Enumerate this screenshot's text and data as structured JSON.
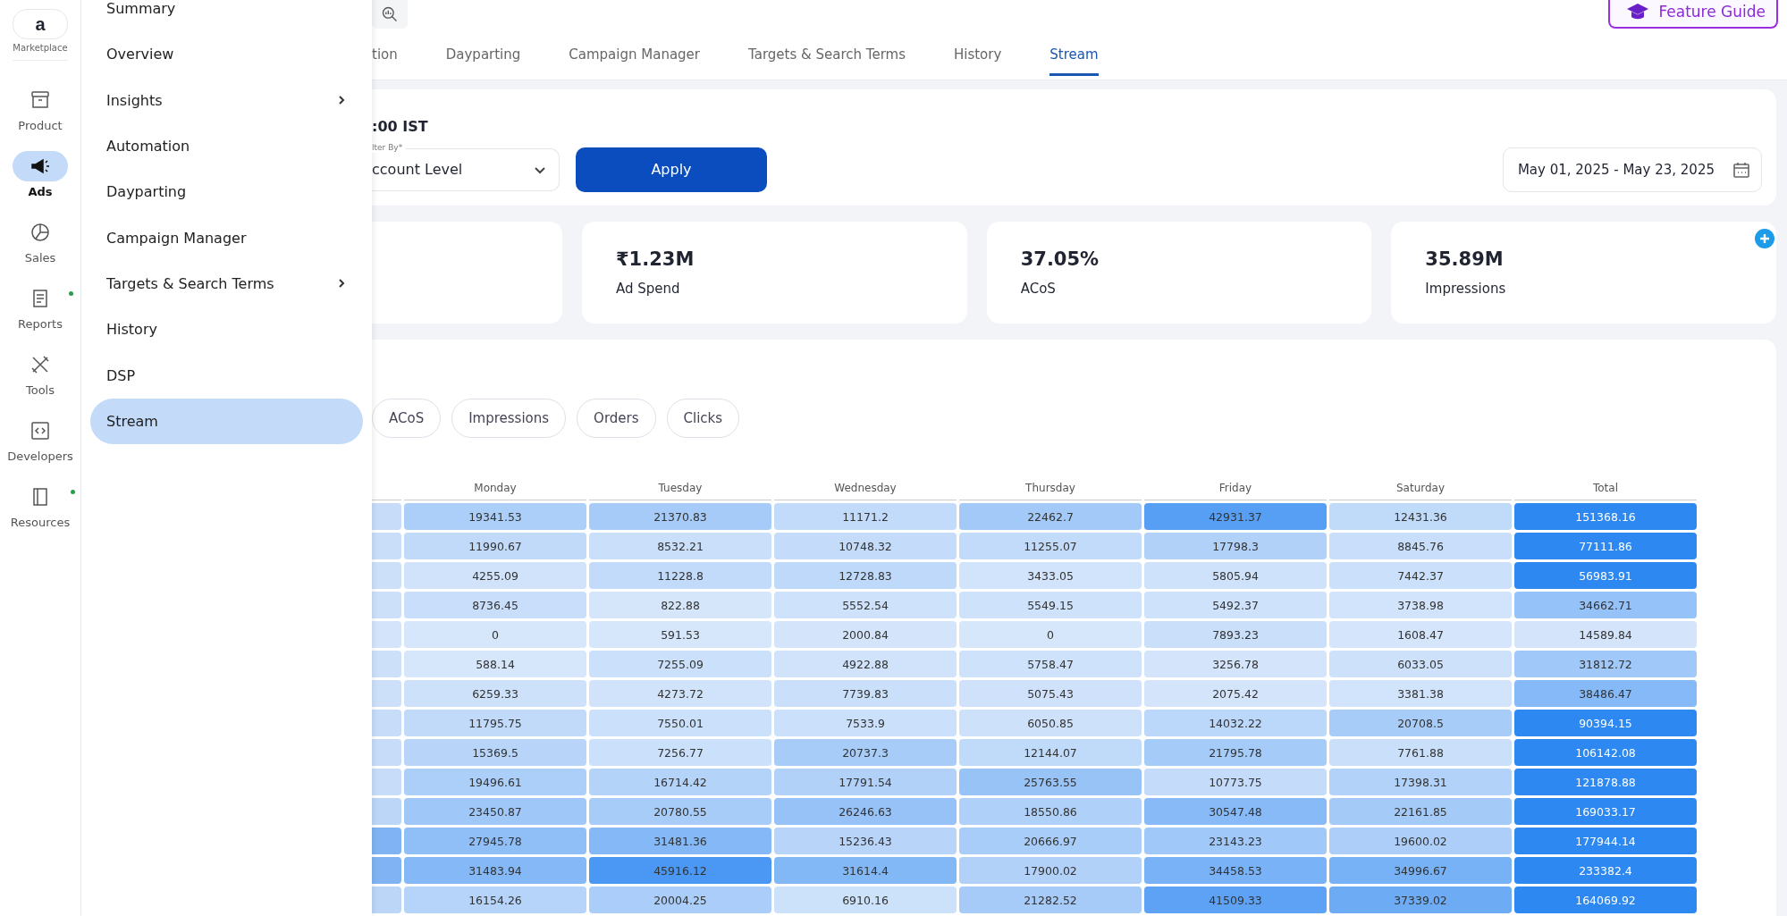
{
  "rail": {
    "logo_letter": "a",
    "logo_label": "Marketplace",
    "items": [
      {
        "label": "Product",
        "selected": false,
        "dot": false
      },
      {
        "label": "Ads",
        "selected": true,
        "dot": false
      },
      {
        "label": "Sales",
        "selected": false,
        "dot": false
      },
      {
        "label": "Reports",
        "selected": false,
        "dot": true
      },
      {
        "label": "Tools",
        "selected": false,
        "dot": false
      },
      {
        "label": "Developers",
        "selected": false,
        "dot": false
      },
      {
        "label": "Resources",
        "selected": false,
        "dot": true
      }
    ]
  },
  "menu": {
    "items": [
      {
        "label": "Summary",
        "has_submenu": false,
        "selected": false
      },
      {
        "label": "Overview",
        "has_submenu": false,
        "selected": false
      },
      {
        "label": "Insights",
        "has_submenu": true,
        "selected": false
      },
      {
        "label": "Automation",
        "has_submenu": false,
        "selected": false
      },
      {
        "label": "Dayparting",
        "has_submenu": false,
        "selected": false
      },
      {
        "label": "Campaign Manager",
        "has_submenu": false,
        "selected": false
      },
      {
        "label": "Targets & Search Terms",
        "has_submenu": true,
        "selected": false
      },
      {
        "label": "History",
        "has_submenu": false,
        "selected": false
      },
      {
        "label": "DSP",
        "has_submenu": false,
        "selected": false
      },
      {
        "label": "Stream",
        "has_submenu": false,
        "selected": true
      }
    ]
  },
  "feature_guide": {
    "label": "Feature Guide"
  },
  "tabs": [
    {
      "label": "tion",
      "selected": false
    },
    {
      "label": "Dayparting",
      "selected": false
    },
    {
      "label": "Campaign Manager",
      "selected": false
    },
    {
      "label": "Targets & Search Terms",
      "selected": false
    },
    {
      "label": "History",
      "selected": false
    },
    {
      "label": "Stream",
      "selected": true
    }
  ],
  "filter": {
    "time_text": ":00 IST",
    "filter_label": "lter By*",
    "filter_value": "ccount Level",
    "apply": "Apply",
    "date_range": "May 01, 2025 - May 23, 2025"
  },
  "metrics": [
    {
      "value": "₹1.23M",
      "label": "Ad Spend"
    },
    {
      "value": "37.05%",
      "label": "ACoS"
    },
    {
      "value": "35.89M",
      "label": "Impressions"
    }
  ],
  "chips": [
    {
      "label": "ACoS",
      "selected": false
    },
    {
      "label": "Impressions",
      "selected": false
    },
    {
      "label": "Orders",
      "selected": false
    },
    {
      "label": "Clicks",
      "selected": false
    }
  ],
  "table": {
    "columns": [
      {
        "label": "Monday",
        "kind": "day"
      },
      {
        "label": "Tuesday",
        "kind": "day"
      },
      {
        "label": "Wednesday",
        "kind": "day"
      },
      {
        "label": "Thursday",
        "kind": "day"
      },
      {
        "label": "Friday",
        "kind": "day"
      },
      {
        "label": "Saturday",
        "kind": "day"
      },
      {
        "label": "Total",
        "kind": "total"
      }
    ],
    "rows": [
      {
        "color": "#c6dcf9",
        "cells": [
          "19341.53",
          "21370.83",
          "11171.2",
          "22462.7",
          "42931.37",
          "12431.36",
          "151368.16"
        ]
      },
      {
        "color": "#c9def9",
        "cells": [
          "11990.67",
          "8532.21",
          "10748.32",
          "11255.07",
          "17798.3",
          "8845.76",
          "77111.86"
        ]
      },
      {
        "color": "#cde0fa",
        "cells": [
          "4255.09",
          "11228.8",
          "12728.83",
          "3433.05",
          "5805.94",
          "7442.37",
          "56983.91"
        ]
      },
      {
        "color": "#cde0fa",
        "cells": [
          "8736.45",
          "822.88",
          "5552.54",
          "5549.15",
          "5492.37",
          "3738.98",
          "34662.71"
        ]
      },
      {
        "color": "#d4e5fb",
        "cells": [
          "0",
          "591.53",
          "2000.84",
          "0",
          "7893.23",
          "1608.47",
          "14589.84"
        ]
      },
      {
        "color": "#cde0fa",
        "cells": [
          "588.14",
          "7255.09",
          "4922.88",
          "5758.47",
          "3256.78",
          "6033.05",
          "31812.72"
        ]
      },
      {
        "color": "#cde0fa",
        "cells": [
          "6259.33",
          "4273.72",
          "7739.83",
          "5075.43",
          "2075.42",
          "3381.38",
          "38486.47"
        ]
      },
      {
        "color": "#c6dcf9",
        "cells": [
          "11795.75",
          "7550.01",
          "7533.9",
          "6050.85",
          "14032.22",
          "20708.5",
          "90394.15"
        ]
      },
      {
        "color": "#c6dcf9",
        "cells": [
          "15369.5",
          "7256.77",
          "20737.3",
          "12144.07",
          "21795.78",
          "7761.88",
          "106142.08"
        ]
      },
      {
        "color": "#c6dcf9",
        "cells": [
          "19496.61",
          "16714.42",
          "17791.54",
          "25763.55",
          "10773.75",
          "17398.31",
          "121878.88"
        ]
      },
      {
        "color": "#bcd6f8",
        "cells": [
          "23450.87",
          "20780.55",
          "26246.63",
          "18550.86",
          "30547.48",
          "22161.85",
          "169033.17"
        ]
      },
      {
        "color": "#7fb3f3",
        "cells": [
          "27945.78",
          "31481.36",
          "15236.43",
          "20666.97",
          "23143.23",
          "19600.02",
          "177944.14"
        ]
      },
      {
        "color": "#7fb3f3",
        "cells": [
          "31483.94",
          "45916.12",
          "31614.4",
          "17900.02",
          "34458.53",
          "34996.67",
          "233382.4"
        ]
      },
      {
        "color": "#bcd6f8",
        "cells": [
          "16154.26",
          "20004.25",
          "6910.16",
          "21282.52",
          "41509.33",
          "37339.02",
          "164069.92"
        ]
      }
    ]
  }
}
